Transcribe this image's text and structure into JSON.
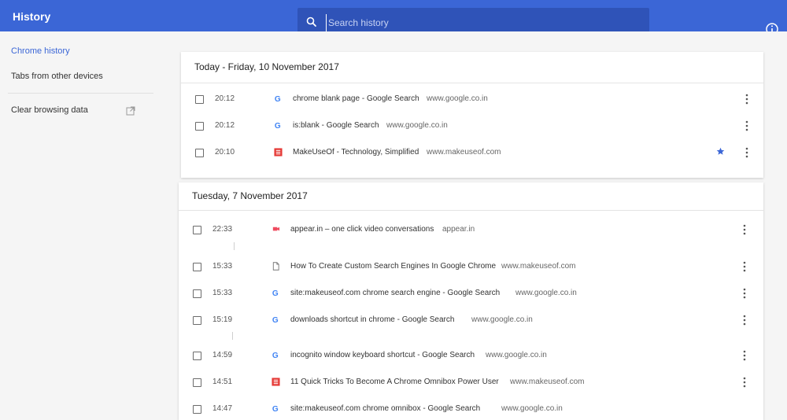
{
  "header": {
    "title": "History",
    "search_placeholder": "Search history"
  },
  "sidebar": {
    "items": [
      {
        "label": "Chrome history"
      },
      {
        "label": "Tabs from other devices"
      },
      {
        "label": "Clear browsing data"
      }
    ]
  },
  "groups": [
    {
      "date": "Today - Friday, 10 November 2017",
      "entries": [
        {
          "time": "20:12",
          "favicon": "google-icon",
          "title": "chrome blank page - Google Search",
          "domain": "www.google.co.in",
          "starred": false
        },
        {
          "time": "20:12",
          "favicon": "google-icon",
          "title": "is:blank - Google Search",
          "domain": "www.google.co.in",
          "starred": false
        },
        {
          "time": "20:10",
          "favicon": "makeuseof-icon",
          "title": "MakeUseOf - Technology, Simplified",
          "domain": "www.makeuseof.com",
          "starred": true
        }
      ]
    },
    {
      "date": "Tuesday, 7 November 2017",
      "entries": [
        {
          "time": "22:33",
          "favicon": "appear-in-icon",
          "title": "appear.in – one click video conversations",
          "domain": "appear.in",
          "starred": false
        },
        {
          "time": "15:33",
          "favicon": "page-icon",
          "title": "How To Create Custom Search Engines In Google Chrome",
          "domain": "www.makeuseof.com",
          "starred": false
        },
        {
          "time": "15:33",
          "favicon": "google-icon",
          "title": "site:makeuseof.com chrome search engine - Google Search",
          "domain": "www.google.co.in",
          "starred": false
        },
        {
          "time": "15:19",
          "favicon": "google-icon",
          "title": "downloads shortcut in chrome - Google Search",
          "domain": "www.google.co.in",
          "starred": false
        },
        {
          "time": "14:59",
          "favicon": "google-icon",
          "title": "incognito window keyboard shortcut - Google Search",
          "domain": "www.google.co.in",
          "starred": false
        },
        {
          "time": "14:51",
          "favicon": "makeuseof-icon",
          "title": "11 Quick Tricks To Become A Chrome Omnibox Power User",
          "domain": "www.makeuseof.com",
          "starred": false
        },
        {
          "time": "14:47",
          "favicon": "google-icon",
          "title": "site:makeuseof.com chrome omnibox - Google Search",
          "domain": "www.google.co.in",
          "starred": false
        }
      ]
    }
  ],
  "colors": {
    "brand": "#3b66d6",
    "search_bg": "#2f53b8",
    "star": "#3b66d6",
    "makeuseof": "#e53935"
  }
}
